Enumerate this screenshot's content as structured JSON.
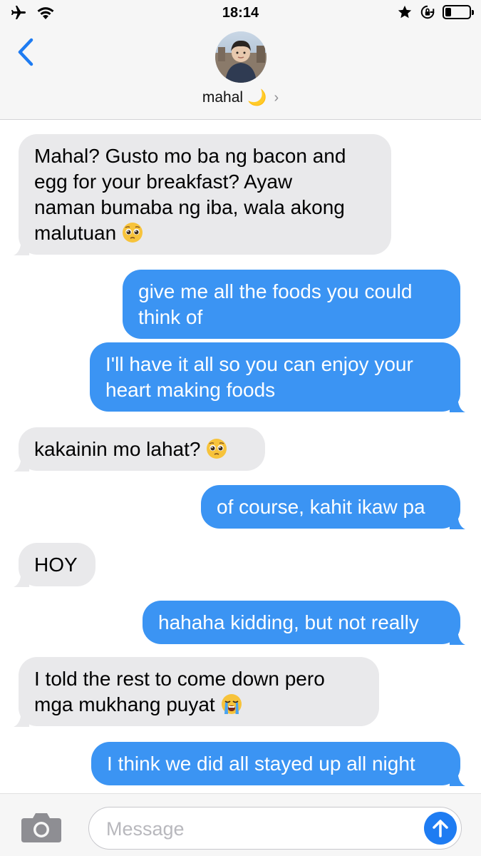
{
  "status_bar": {
    "time": "18:14",
    "battery_level": 0.25,
    "icons": [
      "airplane-icon",
      "wifi-icon",
      "star-icon",
      "orientation-lock-icon",
      "battery-icon"
    ]
  },
  "header": {
    "back_icon": "chevron-left-icon",
    "contact_name": "mahal",
    "contact_emoji": "🌙",
    "chevron": "›"
  },
  "messages": [
    {
      "direction": "in",
      "lines": [
        "Mahal? Gusto mo ba ng bacon and",
        "egg for your breakfast? Ayaw",
        "naman bumaba ng iba, wala akong",
        "malutuan"
      ],
      "emoji": "pleading-face"
    },
    {
      "direction": "out",
      "lines": [
        "give me all the foods you could",
        "think of"
      ]
    },
    {
      "direction": "out",
      "lines": [
        "I'll have it all so you can enjoy your",
        "heart making foods"
      ]
    },
    {
      "direction": "in",
      "lines": [
        "kakainin mo lahat?"
      ],
      "emoji": "pleading-face"
    },
    {
      "direction": "out",
      "lines": [
        "of course, kahit ikaw pa"
      ]
    },
    {
      "direction": "in",
      "lines": [
        "HOY"
      ]
    },
    {
      "direction": "out",
      "lines": [
        "hahaha kidding, but not really"
      ]
    },
    {
      "direction": "in",
      "lines": [
        "I told the rest to come down pero",
        "mga mukhang puyat"
      ],
      "emoji": "loudly-crying-face"
    },
    {
      "direction": "out",
      "lines": [
        "I think we did all stayed up all night"
      ]
    }
  ],
  "input_bar": {
    "placeholder": "Message",
    "camera_icon": "camera-icon",
    "send_icon": "arrow-up-icon"
  },
  "colors": {
    "incoming_bubble": "#e9e9eb",
    "outgoing_bubble": "#3b94f3",
    "accent": "#1e7cf2"
  }
}
